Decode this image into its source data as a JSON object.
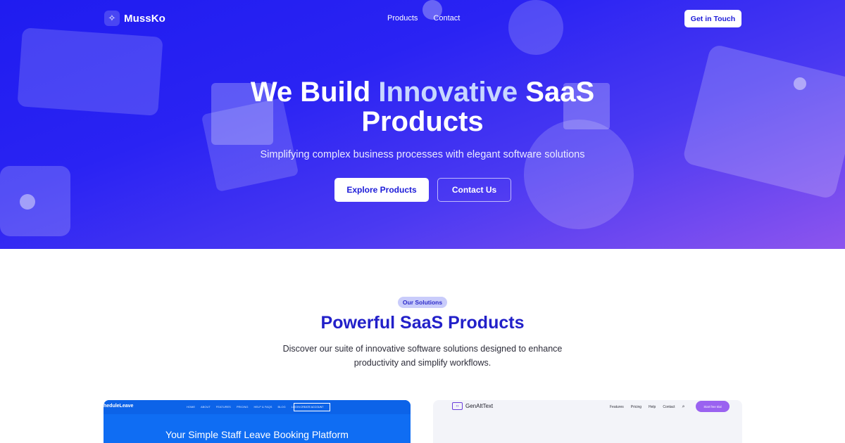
{
  "nav": {
    "brand": "MussKo",
    "logo_icon": "sparkle-icon",
    "links": [
      "Products",
      "Contact"
    ],
    "cta": "Get in Touch"
  },
  "hero": {
    "title_part1": "We Build ",
    "title_highlight": "Innovative",
    "title_part2": " SaaS Products",
    "subtitle": "Simplifying complex business processes with elegant software solutions",
    "primary_button": "Explore Products",
    "secondary_button": "Contact Us"
  },
  "solutions": {
    "badge": "Our Solutions",
    "title": "Powerful SaaS Products",
    "description": "Discover our suite of innovative software solutions designed to enhance productivity and simplify workflows."
  },
  "cards": [
    {
      "logo": "heduleLeave",
      "nav_links": [
        "HOME",
        "ABOUT",
        "FEATURES",
        "PRICING",
        "HELP & FAQS",
        "BLOG",
        "LOGIN"
      ],
      "nav_button": "CREATE ACCOUNT",
      "headline": "Your Simple Staff Leave Booking Platform"
    },
    {
      "logo": "GenAltText",
      "logo_icon": "code-icon",
      "nav_links": [
        "Features",
        "Pricing",
        "Help",
        "Contact"
      ],
      "search_icon": "search-icon",
      "nav_button": "Start free trial"
    }
  ],
  "colors": {
    "hero_gradient_start": "#1f1cf0",
    "hero_gradient_end": "#8d55ee",
    "accent": "#2220c9",
    "badge_bg": "#c9ccfb",
    "card1_bg": "#0f6df3",
    "card2_button": "#9a62f0"
  }
}
